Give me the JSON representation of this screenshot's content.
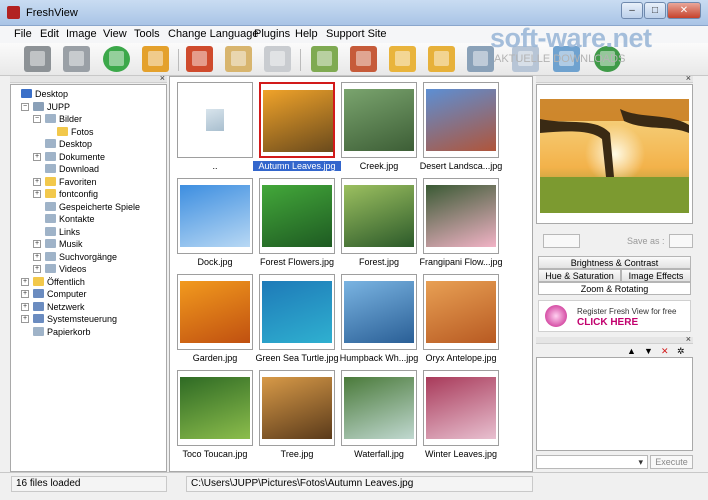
{
  "window": {
    "title": "FreshView",
    "controls": [
      "–",
      "□",
      "✕"
    ]
  },
  "watermark": {
    "main": "soft-ware.net",
    "sub": "AKTUELLE DOWNLOADS"
  },
  "menu": [
    "File",
    "Edit",
    "Image",
    "View",
    "Tools",
    "Change Language",
    "Plugins",
    "Help",
    "Support Site"
  ],
  "toolbar": {
    "icons": [
      "printer-icon",
      "scanner-icon",
      "refresh-icon",
      "home-icon",
      "cut-icon",
      "paste-icon",
      "copy-icon",
      "image-view-icon",
      "slideshow-icon",
      "folder-image-icon",
      "folder-move-icon",
      "export-icon",
      "email-icon",
      "wallpaper-icon",
      "web-icon"
    ]
  },
  "tree": [
    {
      "label": "Desktop",
      "depth": 0,
      "expander": "",
      "icon_color": "#3a6fc8"
    },
    {
      "label": "JUPP",
      "depth": 1,
      "expander": "−",
      "icon_color": "#8aa0b8"
    },
    {
      "label": "Bilder",
      "depth": 2,
      "expander": "−",
      "icon_color": "#9fb3c8"
    },
    {
      "label": "Fotos",
      "depth": 3,
      "expander": "",
      "icon_color": "#f2c84b"
    },
    {
      "label": "Desktop",
      "depth": 2,
      "expander": "",
      "icon_color": "#9fb3c8"
    },
    {
      "label": "Dokumente",
      "depth": 2,
      "expander": "+",
      "icon_color": "#9fb3c8"
    },
    {
      "label": "Download",
      "depth": 2,
      "expander": "",
      "icon_color": "#9fb3c8"
    },
    {
      "label": "Favoriten",
      "depth": 2,
      "expander": "+",
      "icon_color": "#f2c84b"
    },
    {
      "label": "fontconfig",
      "depth": 2,
      "expander": "+",
      "icon_color": "#f2c84b"
    },
    {
      "label": "Gespeicherte Spiele",
      "depth": 2,
      "expander": "",
      "icon_color": "#9fb3c8"
    },
    {
      "label": "Kontakte",
      "depth": 2,
      "expander": "",
      "icon_color": "#9fb3c8"
    },
    {
      "label": "Links",
      "depth": 2,
      "expander": "",
      "icon_color": "#9fb3c8"
    },
    {
      "label": "Musik",
      "depth": 2,
      "expander": "+",
      "icon_color": "#9fb3c8"
    },
    {
      "label": "Suchvorgänge",
      "depth": 2,
      "expander": "+",
      "icon_color": "#9fb3c8"
    },
    {
      "label": "Videos",
      "depth": 2,
      "expander": "+",
      "icon_color": "#9fb3c8"
    },
    {
      "label": "Öffentlich",
      "depth": 1,
      "expander": "+",
      "icon_color": "#f2c84b"
    },
    {
      "label": "Computer",
      "depth": 1,
      "expander": "+",
      "icon_color": "#6b8cc0"
    },
    {
      "label": "Netzwerk",
      "depth": 1,
      "expander": "+",
      "icon_color": "#6b8cc0"
    },
    {
      "label": "Systemsteuerung",
      "depth": 1,
      "expander": "+",
      "icon_color": "#6b8cc0"
    },
    {
      "label": "Papierkorb",
      "depth": 1,
      "expander": "",
      "icon_color": "#9fb3c8"
    }
  ],
  "thumbnails": [
    {
      "label": "..",
      "colors": [
        "#d8e4ec",
        "#a9bfcf"
      ],
      "selected": false
    },
    {
      "label": "Autumn Leaves.jpg",
      "colors": [
        "#f0a32a",
        "#6a4a1c"
      ],
      "selected": true
    },
    {
      "label": "Creek.jpg",
      "colors": [
        "#7aa46e",
        "#3d5e36"
      ],
      "selected": false
    },
    {
      "label": "Desert Landsca...jpg",
      "colors": [
        "#5c8fd4",
        "#b0553a"
      ],
      "selected": false
    },
    {
      "label": "Dock.jpg",
      "colors": [
        "#3d8ee0",
        "#b8d8f4"
      ],
      "selected": false
    },
    {
      "label": "Forest Flowers.jpg",
      "colors": [
        "#43a83a",
        "#1e5a22"
      ],
      "selected": false
    },
    {
      "label": "Forest.jpg",
      "colors": [
        "#9cc060",
        "#2c5a2a"
      ],
      "selected": false
    },
    {
      "label": "Frangipani Flow...jpg",
      "colors": [
        "#3a5a34",
        "#f2b3c6"
      ],
      "selected": false
    },
    {
      "label": "Garden.jpg",
      "colors": [
        "#f29a1e",
        "#c05010"
      ],
      "selected": false
    },
    {
      "label": "Green Sea Turtle.jpg",
      "colors": [
        "#1e7ab8",
        "#2fb0d0"
      ],
      "selected": false
    },
    {
      "label": "Humpback Wh...jpg",
      "colors": [
        "#7ab4e2",
        "#2a5f96"
      ],
      "selected": false
    },
    {
      "label": "Oryx Antelope.jpg",
      "colors": [
        "#e8a054",
        "#b85a22"
      ],
      "selected": false
    },
    {
      "label": "Toco Toucan.jpg",
      "colors": [
        "#2e6a24",
        "#8cbd4c"
      ],
      "selected": false
    },
    {
      "label": "Tree.jpg",
      "colors": [
        "#d89a48",
        "#5a3a1a"
      ],
      "selected": false
    },
    {
      "label": "Waterfall.jpg",
      "colors": [
        "#4a7a3a",
        "#c0d8d0"
      ],
      "selected": false
    },
    {
      "label": "Winter Leaves.jpg",
      "colors": [
        "#a83a5a",
        "#e8c0d0"
      ],
      "selected": false
    }
  ],
  "side": {
    "save_as": "Save as :",
    "tabs": [
      "Brightness & Contrast",
      "Hue & Saturation",
      "Image Effects",
      "Zoom & Rotating"
    ],
    "banner": {
      "line1": "Register Fresh View for free",
      "line2": "CLICK HERE"
    },
    "mini_buttons": [
      "▲",
      "▼",
      "✕",
      "✲"
    ],
    "execute": "Execute"
  },
  "status": {
    "count": "16 files loaded",
    "path": "C:\\Users\\JUPP\\Pictures\\Fotos\\Autumn Leaves.jpg"
  }
}
